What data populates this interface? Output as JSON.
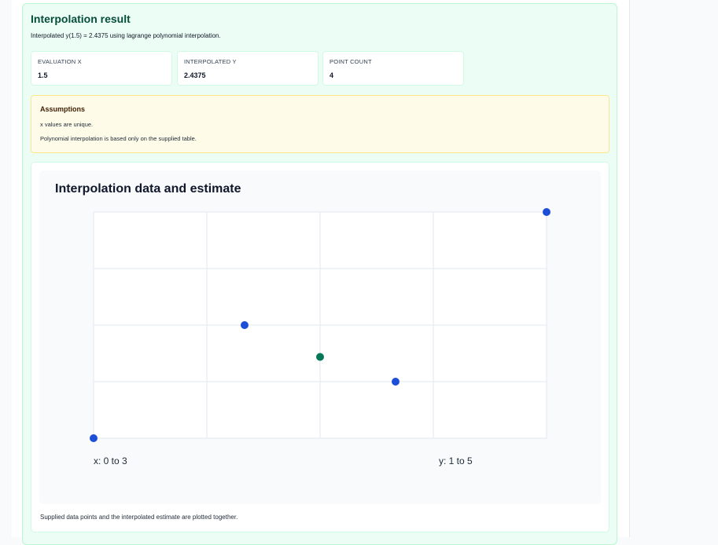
{
  "result": {
    "title": "Interpolation result",
    "summary": "Interpolated y(1.5) = 2.4375 using lagrange polynomial interpolation."
  },
  "stats": [
    {
      "label": "EVALUATION X",
      "value": "1.5"
    },
    {
      "label": "INTERPOLATED Y",
      "value": "2.4375"
    },
    {
      "label": "POINT COUNT",
      "value": "4"
    }
  ],
  "assumptions": {
    "title": "Assumptions",
    "items": [
      "x values are unique.",
      "Polynomial interpolation is based only on the supplied table."
    ]
  },
  "chart": {
    "caption": "Supplied data points and the interpolated estimate are plotted together."
  },
  "chart_data": {
    "type": "scatter",
    "title": "Interpolation data and estimate",
    "x_range_label": "x: 0 to 3",
    "y_range_label": "y: 1 to 5",
    "xlim": [
      0,
      3
    ],
    "ylim": [
      1,
      5
    ],
    "grid": true,
    "series": [
      {
        "points": [
          [
            0,
            1
          ],
          [
            1,
            3
          ],
          [
            2,
            2
          ],
          [
            3,
            5
          ]
        ],
        "color": "#1d4ed8"
      },
      {
        "points": [
          [
            1.5,
            2.4375
          ]
        ],
        "color": "#047857"
      }
    ]
  }
}
